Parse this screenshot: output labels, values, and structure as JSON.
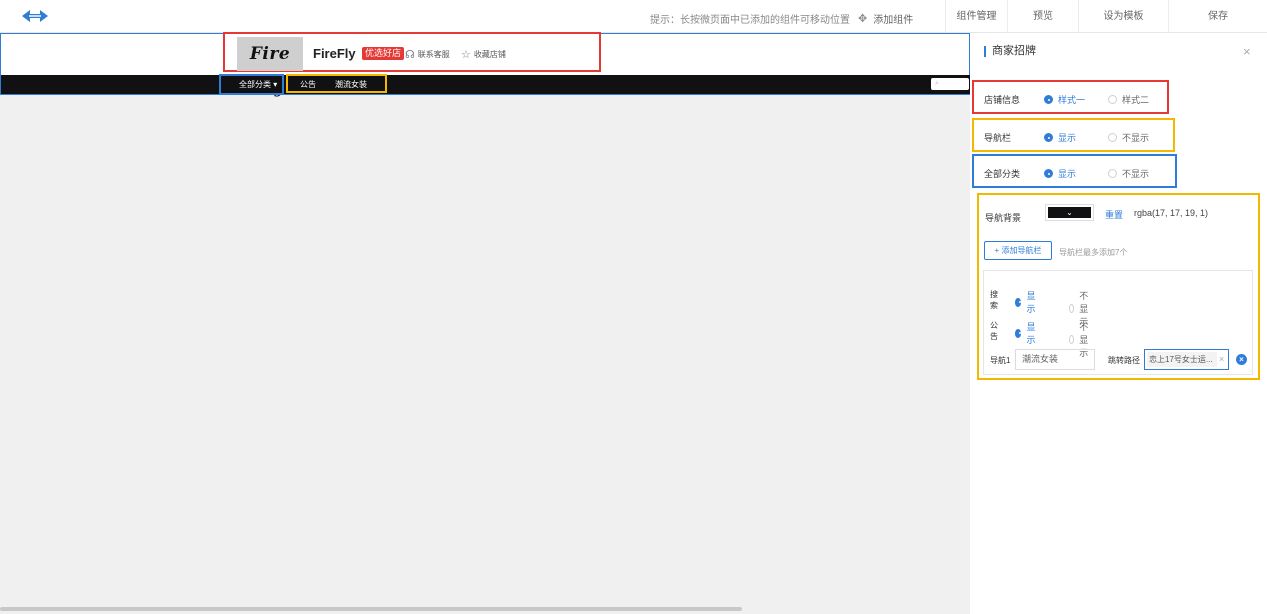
{
  "topbar": {
    "hint": "提示：长按微页面中已添加的组件可移动位置",
    "add_component": "添加组件",
    "actions": [
      "组件管理",
      "预览",
      "设为模板",
      "保存"
    ]
  },
  "canvas": {
    "brand_logo_text": "Fire Fly",
    "store_name": "FireFly",
    "badge": "优选好店",
    "contact_service": "联系客服",
    "favorite_store": "收藏店铺",
    "category_label": "全部分类 ▾",
    "nav_items": [
      "公告",
      "潮流女装"
    ]
  },
  "panel": {
    "title": "商家招牌",
    "close": "×",
    "store_info": {
      "label": "店铺信息",
      "options": [
        "样式一",
        "样式二"
      ],
      "selected": 0
    },
    "navbar": {
      "label": "导航栏",
      "options": [
        "显示",
        "不显示"
      ],
      "selected": 0
    },
    "all_category": {
      "label": "全部分类",
      "options": [
        "显示",
        "不显示"
      ],
      "selected": 0
    },
    "nav_background": {
      "label": "导航背景",
      "color": "#111113",
      "reset": "重置",
      "rgba": "rgba(17, 17, 19, 1)"
    },
    "add_nav_button": "+ 添加导航栏",
    "add_nav_hint": "导航栏最多添加7个",
    "search": {
      "label": "搜索",
      "options": [
        "显示",
        "不显示"
      ],
      "selected": 0
    },
    "notice": {
      "label": "公告",
      "options": [
        "显示",
        "不显示"
      ],
      "selected": 0
    },
    "nav1": {
      "label": "导航1",
      "value": "潮流女装",
      "jump_label": "跳转路径",
      "jump_value": "恋上17号女士运..."
    }
  },
  "colors": {
    "accent": "#2f7dd9",
    "store_box": "#e53935",
    "nav_box": "#f5b800"
  }
}
